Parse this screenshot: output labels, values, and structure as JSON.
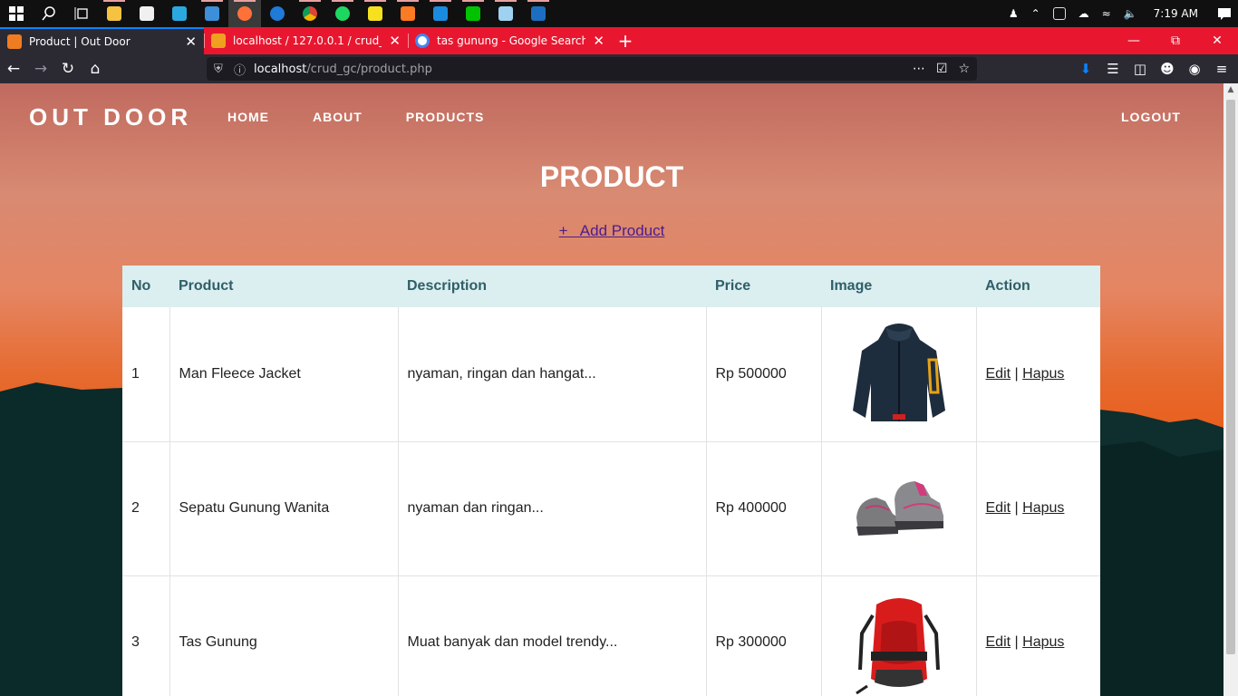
{
  "taskbar": {
    "apps": [
      "file-explorer",
      "store",
      "l-app",
      "mail",
      "firefox",
      "edge",
      "chrome",
      "spotify",
      "sticky-notes",
      "xampp",
      "vscode",
      "line",
      "notepad",
      "photos"
    ],
    "clock": "7:19 AM"
  },
  "tabs": [
    {
      "label": "Product | Out Door",
      "active": true,
      "favicon_color": "#f07c22"
    },
    {
      "label": "localhost / 127.0.0.1 / crud_gc |",
      "active": false,
      "favicon_color": "#f0a020"
    },
    {
      "label": "tas gunung - Google Search",
      "active": false,
      "favicon_color": "#4285f4"
    }
  ],
  "urlbar": {
    "host": "localhost",
    "path": "/crud_gc/product.php"
  },
  "site": {
    "brand": "OUT DOOR",
    "menu": [
      "HOME",
      "ABOUT",
      "PRODUCTS"
    ],
    "logout": "LOGOUT",
    "title": "PRODUCT",
    "add_label": "+   Add Product"
  },
  "table": {
    "headers": [
      "No",
      "Product",
      "Description",
      "Price",
      "Image",
      "Action"
    ],
    "edit_label": "Edit",
    "sep": "|",
    "delete_label": "Hapus",
    "rows": [
      {
        "no": "1",
        "product": "Man Fleece Jacket",
        "description": "nyaman, ringan dan hangat...",
        "price": "Rp 500000",
        "image": "jacket"
      },
      {
        "no": "2",
        "product": "Sepatu Gunung Wanita",
        "description": "nyaman dan ringan...",
        "price": "Rp 400000",
        "image": "hiking-shoe"
      },
      {
        "no": "3",
        "product": "Tas Gunung",
        "description": "Muat banyak dan model trendy...",
        "price": "Rp 300000",
        "image": "backpack"
      }
    ]
  }
}
